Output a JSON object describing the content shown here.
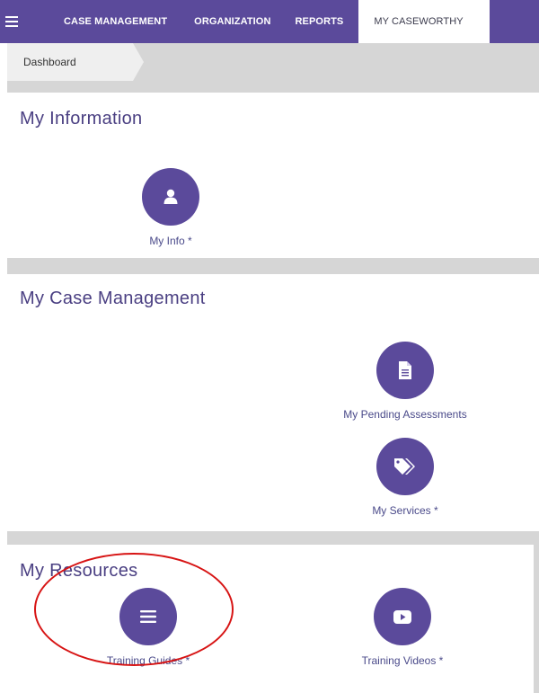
{
  "topnav": {
    "menu_icon": "hamburger-icon",
    "items": [
      {
        "label": "CASE MANAGEMENT"
      },
      {
        "label": "ORGANIZATION"
      },
      {
        "label": "REPORTS"
      },
      {
        "label": "MY CASEWORTHY",
        "active": true
      }
    ],
    "accent_color": "#5b4a9b"
  },
  "breadcrumb": {
    "label": "Dashboard"
  },
  "sections": [
    {
      "title": "My Information",
      "tiles": [
        {
          "label": "My Info *",
          "icon": "user-icon"
        }
      ]
    },
    {
      "title": "My Case Management",
      "tiles": [
        {
          "label": "My Pending Assessments",
          "icon": "document-icon"
        },
        {
          "label": "My Services *",
          "icon": "tags-icon"
        }
      ]
    },
    {
      "title": "My Resources",
      "tiles": [
        {
          "label": "Training Guides *",
          "icon": "list-icon"
        },
        {
          "label": "Training Videos *",
          "icon": "youtube-icon"
        }
      ]
    }
  ],
  "annotation": {
    "color": "#d71414",
    "target": "Training Guides *"
  }
}
